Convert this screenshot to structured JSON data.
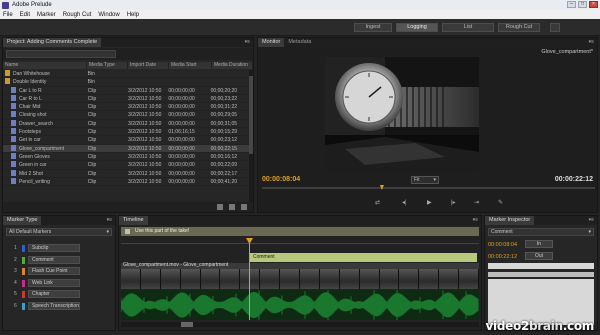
{
  "window": {
    "title": "Adobe Prelude"
  },
  "menu": [
    "File",
    "Edit",
    "Marker",
    "Rough Cut",
    "Window",
    "Help"
  ],
  "workspaces": [
    {
      "label": "Ingest",
      "active": false
    },
    {
      "label": "Logging",
      "active": true
    },
    {
      "label": "List",
      "active": false
    },
    {
      "label": "Rough Cut",
      "active": false
    }
  ],
  "project": {
    "tab": "Project: Adding Comments Complete",
    "columns": [
      "Name",
      "Media Type",
      "Import Date",
      "Media Start",
      "Media Duration"
    ],
    "rows": [
      {
        "name": "Dan Whitehouse",
        "type": "Bin",
        "date": "",
        "start": "",
        "duration": "",
        "icon": "folder",
        "indent": 0
      },
      {
        "name": "Double Identity",
        "type": "Bin",
        "date": "",
        "start": "",
        "duration": "",
        "icon": "folder",
        "indent": 0
      },
      {
        "name": "Car L to R",
        "type": "Clip",
        "date": "3/2/2012 10:50",
        "start": "00;00;00;00",
        "duration": "00;00;20;20",
        "icon": "clip",
        "indent": 1
      },
      {
        "name": "Car R to L",
        "type": "Clip",
        "date": "3/2/2012 10:50",
        "start": "00;00;00;00",
        "duration": "00;00;23;22",
        "icon": "clip",
        "indent": 1
      },
      {
        "name": "Chair Mid",
        "type": "Clip",
        "date": "3/2/2012 10:50",
        "start": "00;00;00;00",
        "duration": "00;00;31;22",
        "icon": "clip",
        "indent": 1
      },
      {
        "name": "Closing shot",
        "type": "Clip",
        "date": "3/2/2012 10:50",
        "start": "00;00;00;00",
        "duration": "00;00;29;05",
        "icon": "clip",
        "indent": 1
      },
      {
        "name": "Drawer_search",
        "type": "Clip",
        "date": "3/2/2012 10:50",
        "start": "00;00;00;00",
        "duration": "00;00;31;05",
        "icon": "clip",
        "indent": 1
      },
      {
        "name": "Footsteps",
        "type": "Clip",
        "date": "3/2/2012 10:50",
        "start": "01;06;16;15",
        "duration": "00;00;15;29",
        "icon": "clip",
        "indent": 1
      },
      {
        "name": "Get in car",
        "type": "Clip",
        "date": "3/2/2012 10:50",
        "start": "00;00;00;00",
        "duration": "00;00;23;12",
        "icon": "clip",
        "indent": 1
      },
      {
        "name": "Glove_compartment",
        "type": "Clip",
        "date": "3/2/2012 10:50",
        "start": "00;00;00;00",
        "duration": "00;00;22;15",
        "icon": "clip",
        "indent": 1,
        "selected": true
      },
      {
        "name": "Green Gloves",
        "type": "Clip",
        "date": "3/2/2012 10:50",
        "start": "00;00;00;00",
        "duration": "00;00;16;12",
        "icon": "clip",
        "indent": 1
      },
      {
        "name": "Green in car",
        "type": "Clip",
        "date": "3/2/2012 10:50",
        "start": "00;00;00;00",
        "duration": "00;00;22;09",
        "icon": "clip",
        "indent": 1
      },
      {
        "name": "Mid 2 Shot",
        "type": "Clip",
        "date": "3/2/2012 10:50",
        "start": "00;00;00;00",
        "duration": "00;00;22;17",
        "icon": "clip",
        "indent": 1
      },
      {
        "name": "Pencil_writing",
        "type": "Clip",
        "date": "3/2/2012 10:50",
        "start": "00;00;00;00",
        "duration": "00;00;41;20",
        "icon": "clip",
        "indent": 1
      }
    ]
  },
  "monitor": {
    "tabs": [
      "Monitor",
      "Metadata"
    ],
    "clip_name": "Glove_compartment*",
    "timecode_current": "00:00:08:04",
    "timecode_duration": "00:00:22:12",
    "zoom": "Fit",
    "playhead_fraction": 0.36
  },
  "marker_type": {
    "tab": "Marker Type",
    "filter": "All Default Markers",
    "items": [
      {
        "num": "1",
        "label": "Subclip",
        "color": "#2f5fd0"
      },
      {
        "num": "2",
        "label": "Comment",
        "color": "#4caf2f"
      },
      {
        "num": "3",
        "label": "Flash Cue Point",
        "color": "#d8872a"
      },
      {
        "num": "4",
        "label": "Web Link",
        "color": "#c02d8a"
      },
      {
        "num": "5",
        "label": "Chapter",
        "color": "#c83c2c"
      },
      {
        "num": "6",
        "label": "Speech Transcription",
        "color": "#3aa0c8"
      }
    ]
  },
  "timeline": {
    "tab": "Timeline",
    "subtitle_text": "Use this part of the take!",
    "marker_label": "Comment",
    "clip_label": "Glove_compartment.mov - Glove_compartment"
  },
  "inspector": {
    "tab": "Marker Inspector",
    "type": "Comment",
    "in_tc": "00:00:08:04",
    "out_tc": "00:00:22:12",
    "in_label": "In",
    "out_label": "Out"
  },
  "watermark": {
    "brand": "video2",
    "suffix": "brain",
    "domain": ".com"
  },
  "colors": {
    "accent": "#e0a020",
    "comment": "#b6c97d",
    "audio": "#1f9a3a"
  }
}
